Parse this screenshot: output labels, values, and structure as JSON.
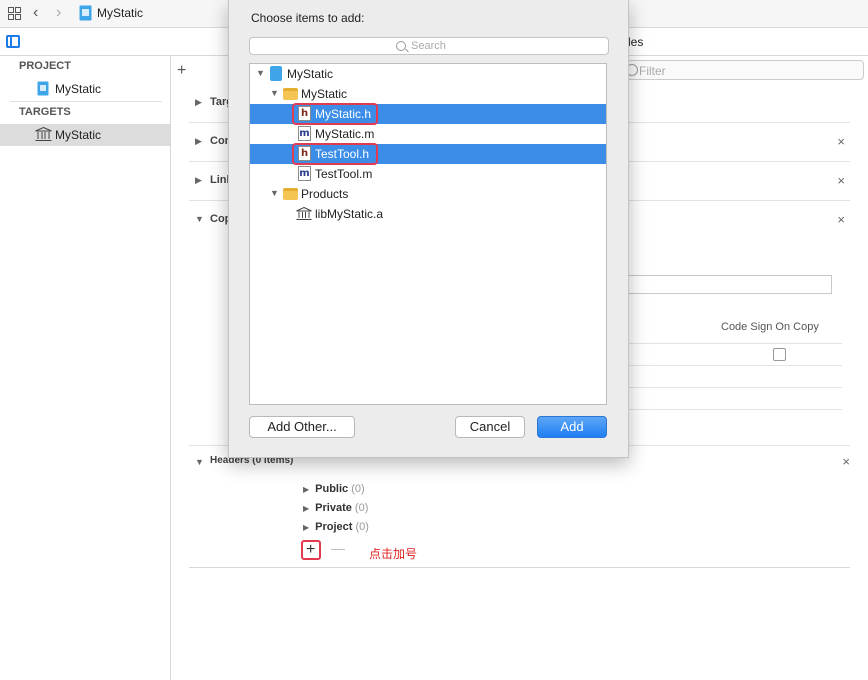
{
  "window": {
    "title": "MyStatic"
  },
  "toolbar": {
    "visible_tab": "les"
  },
  "sidebar": {
    "project_header": "PROJECT",
    "project_item": "MyStatic",
    "targets_header": "TARGETS",
    "target_item": "MyStatic"
  },
  "main": {
    "filter_placeholder": "Filter",
    "phases": [
      {
        "label": "Targ"
      },
      {
        "label": "Con"
      },
      {
        "label": "Link"
      },
      {
        "label": "Cop"
      }
    ],
    "copy_column": "Code Sign On Copy",
    "headers": {
      "title": "Headers (0 items)",
      "sections": [
        {
          "name": "Public",
          "count": "(0)"
        },
        {
          "name": "Private",
          "count": "(0)"
        },
        {
          "name": "Project",
          "count": "(0)"
        }
      ]
    },
    "annotation": "点击加号"
  },
  "dialog": {
    "title": "Choose items to add:",
    "search_placeholder": "Search",
    "tree": [
      {
        "label": "MyStatic",
        "kind": "project",
        "depth": 0,
        "expanded": true
      },
      {
        "label": "MyStatic",
        "kind": "folder",
        "depth": 1,
        "expanded": true
      },
      {
        "label": "MyStatic.h",
        "kind": "header",
        "depth": 2,
        "selected": true
      },
      {
        "label": "MyStatic.m",
        "kind": "source",
        "depth": 2
      },
      {
        "label": "TestTool.h",
        "kind": "header",
        "depth": 2,
        "selected": true
      },
      {
        "label": "TestTool.m",
        "kind": "source",
        "depth": 2
      },
      {
        "label": "Products",
        "kind": "folder",
        "depth": 1,
        "expanded": true
      },
      {
        "label": "libMyStatic.a",
        "kind": "library",
        "depth": 2
      }
    ],
    "add_other_label": "Add Other...",
    "cancel_label": "Cancel",
    "add_label": "Add"
  },
  "colors": {
    "accent": "#3b8de8",
    "highlight": "#e23a4f",
    "annotation": "#e02020"
  }
}
